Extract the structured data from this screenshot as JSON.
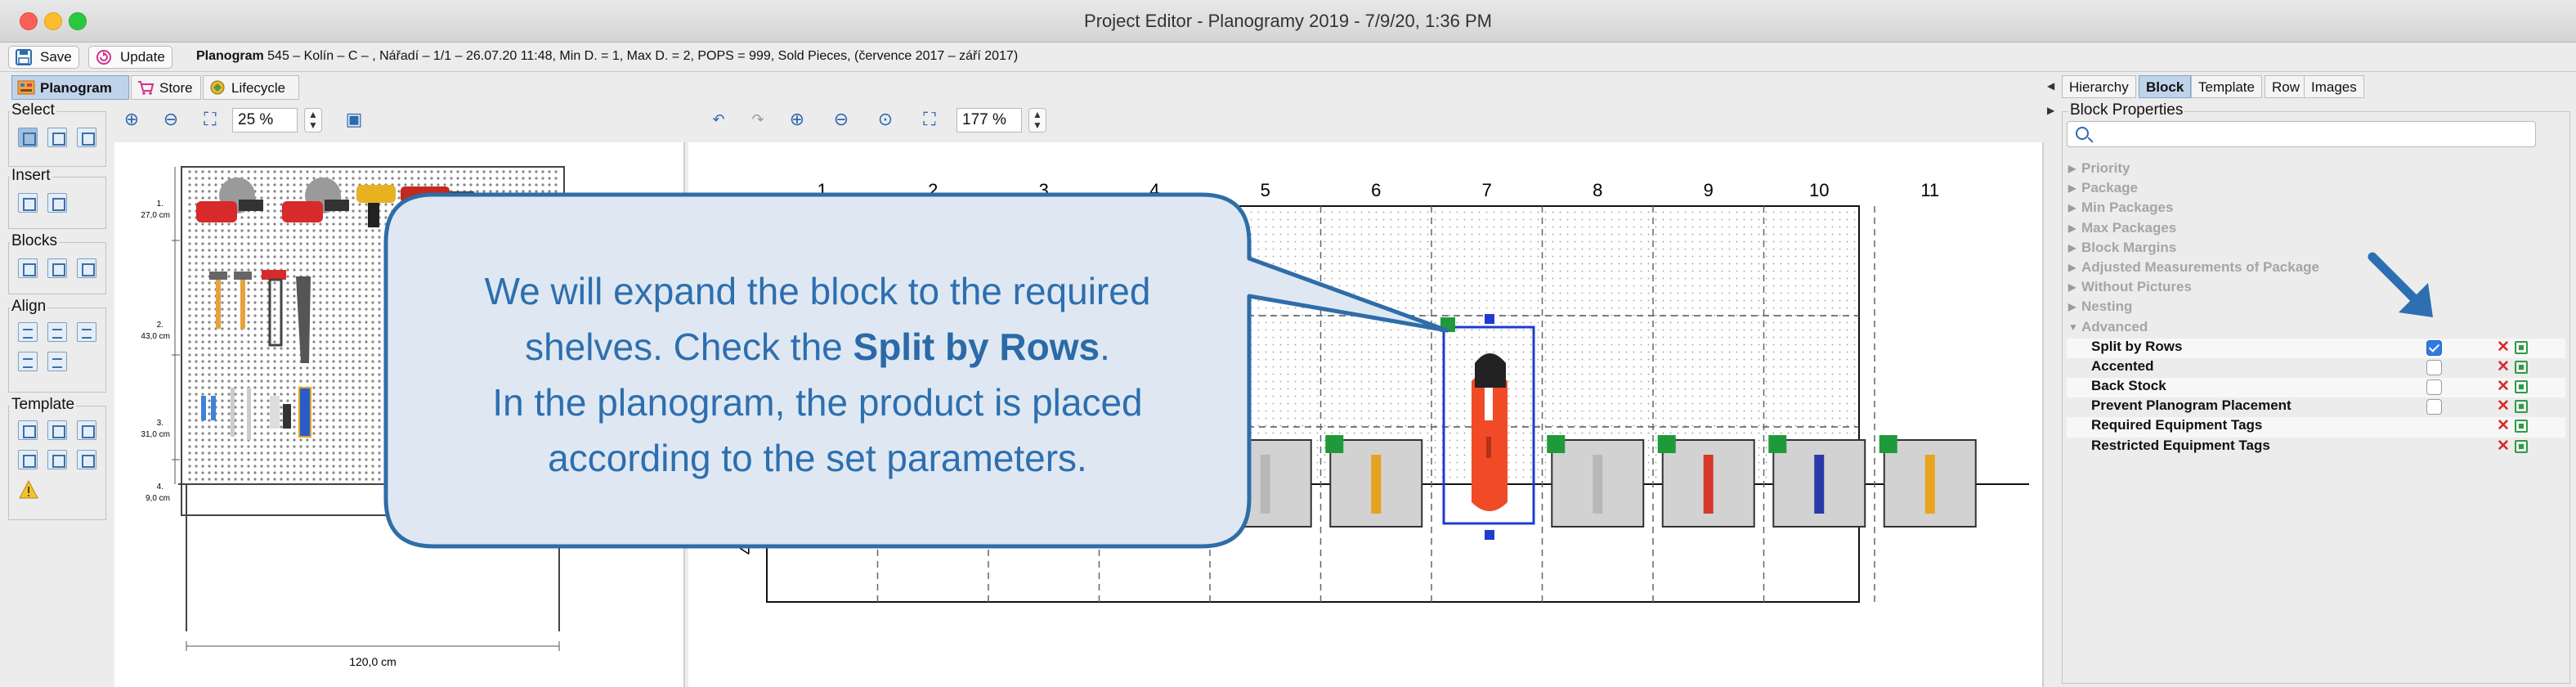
{
  "window": {
    "title": "Project Editor - Planogramy 2019 - 7/9/20, 1:36 PM"
  },
  "toolbar": {
    "save_label": "Save",
    "update_label": "Update",
    "planogram_label": "Planogram",
    "planogram_info": "545 – Kolín – C – , Nářadí – 1/1 – 26.07.20 11:48, Min D. = 1, Max D. = 2, POPS = 999, Sold Pieces, (července 2017 – září 2017)"
  },
  "tabs": [
    {
      "label": "Planogram",
      "active": true
    },
    {
      "label": "Store",
      "active": false
    },
    {
      "label": "Lifecycle",
      "active": false
    }
  ],
  "palette": {
    "select": "Select",
    "insert": "Insert",
    "blocks": "Blocks",
    "align": "Align",
    "template": "Template"
  },
  "overview": {
    "zoom": "25 %",
    "shelves": [
      {
        "num": "1.",
        "height": "27,0 cm"
      },
      {
        "num": "2.",
        "height": "43,0 cm"
      },
      {
        "num": "3.",
        "height": "31,0 cm"
      },
      {
        "num": "4.",
        "height": "9,0 cm"
      }
    ],
    "width": "120,0 cm"
  },
  "main": {
    "zoom": "177 %",
    "columns": [
      "1",
      "2",
      "3",
      "4",
      "5",
      "6",
      "7",
      "8",
      "9",
      "10",
      "11"
    ],
    "row_label": "4"
  },
  "right": {
    "tabs": [
      {
        "label": "Hierarchy",
        "active": false
      },
      {
        "label": "Block",
        "active": true
      },
      {
        "label": "Template",
        "active": false
      },
      {
        "label": "Row",
        "active": false
      },
      {
        "label": "Images",
        "active": false
      }
    ],
    "title": "Block Properties",
    "categories": [
      {
        "label": "Priority"
      },
      {
        "label": "Package"
      },
      {
        "label": "Min Packages"
      },
      {
        "label": "Max Packages"
      },
      {
        "label": "Block Margins"
      },
      {
        "label": "Adjusted Measurements of Package"
      },
      {
        "label": "Without Pictures"
      },
      {
        "label": "Nesting"
      },
      {
        "label": "Advanced",
        "open": true
      }
    ],
    "properties": [
      {
        "label": "Split by Rows",
        "checked": true,
        "checkbox": true
      },
      {
        "label": "Accented",
        "checked": false,
        "checkbox": true
      },
      {
        "label": "Back Stock",
        "checked": false,
        "checkbox": true
      },
      {
        "label": "Prevent Planogram Placement",
        "checked": false,
        "checkbox": true
      },
      {
        "label": "Required Equipment Tags",
        "checkbox": false
      },
      {
        "label": "Restricted Equipment Tags",
        "checkbox": false
      }
    ]
  },
  "callout": {
    "line1": "We will expand the block to the required",
    "line2_pre": "shelves. Check the ",
    "line2_bold": "Split by Rows",
    "line2_post": ".",
    "line3": "In the planogram, the product is placed",
    "line4": "according to the set parameters."
  },
  "colors": {
    "accent": "#2d6fb0",
    "callout_fill": "#dfe8f2",
    "callout_border": "#2e6da8",
    "selection": "#1f3ccf",
    "block_marker": "#1f9a3a"
  }
}
